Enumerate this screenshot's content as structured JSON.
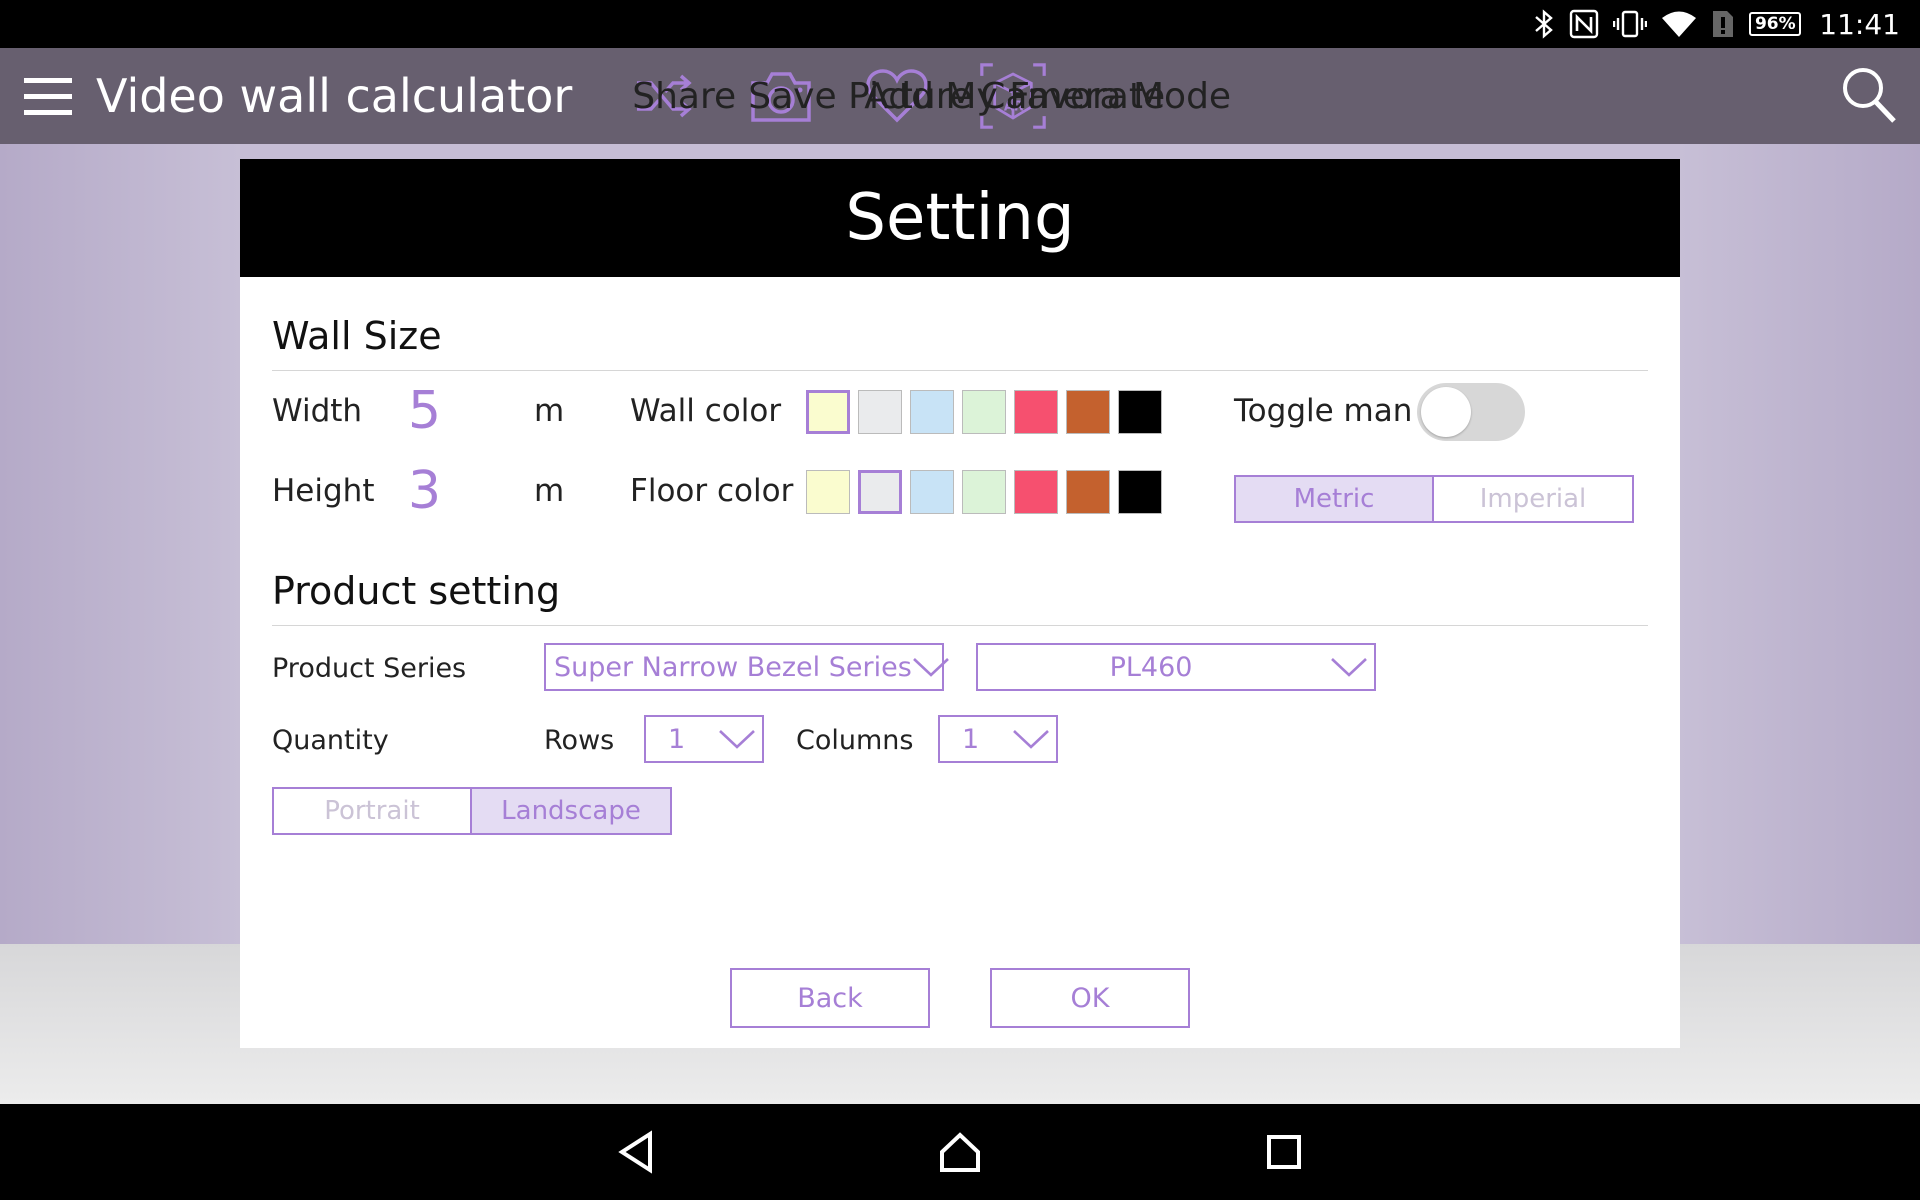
{
  "status_bar": {
    "battery": "96%",
    "time": "11:41",
    "icons": [
      "bluetooth-icon",
      "nfc-icon",
      "vibrate-icon",
      "wifi-icon",
      "sim-alert-icon",
      "battery-icon"
    ]
  },
  "toolbar": {
    "title": "Video wall calculator",
    "actions": [
      {
        "label": "Share",
        "icon": "shuffle-icon"
      },
      {
        "label": "Save Picture",
        "icon": "camera-icon"
      },
      {
        "label": "Add My Favorate",
        "icon": "heart-icon"
      },
      {
        "label": "Camera Mode",
        "icon": "ar-cube-icon"
      }
    ]
  },
  "dialog": {
    "title": "Setting",
    "wall_size": {
      "heading": "Wall Size",
      "width_label": "Width",
      "width_value": "5",
      "width_unit": "m",
      "height_label": "Height",
      "height_value": "3",
      "height_unit": "m",
      "wall_color_label": "Wall color",
      "floor_color_label": "Floor color",
      "colors": [
        "#fafccf",
        "#eaebed",
        "#c8e3f6",
        "#dcf3d8",
        "#f6506f",
        "#c4612e",
        "#000000"
      ],
      "wall_color_selected": 0,
      "floor_color_selected": 1,
      "toggle_label": "Toggle man",
      "toggle_on": false,
      "units": {
        "metric": "Metric",
        "imperial": "Imperial",
        "selected": "metric"
      }
    },
    "product": {
      "heading": "Product setting",
      "series_label": "Product Series",
      "series_value": "Super Narrow Bezel Series",
      "model_value": "PL460",
      "quantity_label": "Quantity",
      "rows_label": "Rows",
      "rows_value": "1",
      "columns_label": "Columns",
      "columns_value": "1",
      "orientation": {
        "portrait": "Portrait",
        "landscape": "Landscape",
        "selected": "landscape"
      }
    },
    "back_label": "Back",
    "ok_label": "OK"
  },
  "accent_color": "#a67fd6",
  "toolbar_color": "#675f6f"
}
